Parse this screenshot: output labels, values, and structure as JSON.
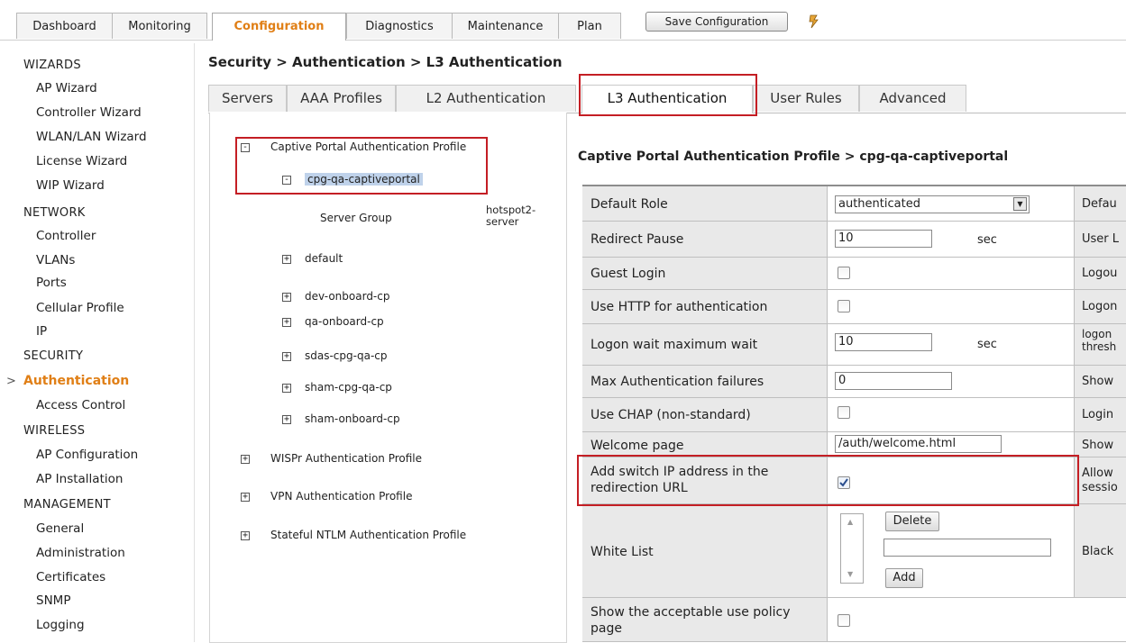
{
  "nav": {
    "tabs": [
      "Dashboard",
      "Monitoring",
      "Configuration",
      "Diagnostics",
      "Maintenance",
      "Plan"
    ],
    "active": "Configuration",
    "save_label": "Save Configuration"
  },
  "sidebar": {
    "wizards": "WIZARDS",
    "wizard_items": [
      "AP Wizard",
      "Controller Wizard",
      "WLAN/LAN Wizard",
      "License Wizard",
      "WIP Wizard"
    ],
    "network": "NETWORK",
    "network_items": [
      "Controller",
      "VLANs",
      "Ports",
      "Cellular Profile",
      "IP"
    ],
    "security": "SECURITY",
    "security_active": "Authentication",
    "security_items": [
      "Access Control"
    ],
    "wireless": "WIRELESS",
    "wireless_items": [
      "AP Configuration",
      "AP Installation"
    ],
    "management": "MANAGEMENT",
    "management_items": [
      "General",
      "Administration",
      "Certificates",
      "SNMP",
      "Logging"
    ]
  },
  "breadcrumb": "Security > Authentication > L3 Authentication",
  "subtabs": [
    "Servers",
    "AAA Profiles",
    "L2 Authentication",
    "L3 Authentication",
    "User Rules",
    "Advanced"
  ],
  "tree": {
    "captive_root": "Captive Portal Authentication Profile",
    "selected_profile": "cpg-qa-captiveportal",
    "server_group_label": "Server Group",
    "server_group_value_1": "hotspot2-",
    "server_group_value_2": "server",
    "profiles": [
      "default",
      "dev-onboard-cp",
      "qa-onboard-cp",
      "sdas-cpg-qa-cp",
      "sham-cpg-qa-cp",
      "sham-onboard-cp"
    ],
    "other_roots": [
      "WISPr Authentication Profile",
      "VPN Authentication Profile",
      "Stateful NTLM Authentication Profile"
    ]
  },
  "panel": {
    "title": "Captive Portal Authentication Profile > cpg-qa-captiveportal",
    "rows": {
      "default_role": {
        "label": "Default Role",
        "value": "authenticated",
        "right": "Defau"
      },
      "redirect_pause": {
        "label": "Redirect Pause",
        "value": "10",
        "unit": "sec",
        "right": "User L"
      },
      "guest_login": {
        "label": "Guest Login",
        "right": "Logou"
      },
      "use_http": {
        "label": "Use HTTP for authentication",
        "right": "Logon"
      },
      "logon_wait": {
        "label": "Logon wait maximum wait",
        "value": "10",
        "unit": "sec",
        "right_1": "logon",
        "right_2": "thresh"
      },
      "max_auth": {
        "label": "Max Authentication failures",
        "value": "0",
        "right": "Show"
      },
      "use_chap": {
        "label": "Use CHAP (non-standard)",
        "right": "Login"
      },
      "welcome": {
        "label": "Welcome page",
        "value": "/auth/welcome.html",
        "right": "Show"
      },
      "add_switch_ip": {
        "label_1": "Add switch IP address in the",
        "label_2": "redirection URL",
        "checked": true,
        "right_1": "Allow",
        "right_2": "sessio"
      },
      "white_list": {
        "label": "White List",
        "delete": "Delete",
        "add": "Add",
        "right": "Black"
      },
      "show_aup": {
        "label_1": "Show the acceptable use policy",
        "label_2": "page"
      }
    }
  },
  "colors": {
    "accent": "#e07f16",
    "highlight": "#c41e24",
    "label_bg": "#e9e9e9"
  }
}
